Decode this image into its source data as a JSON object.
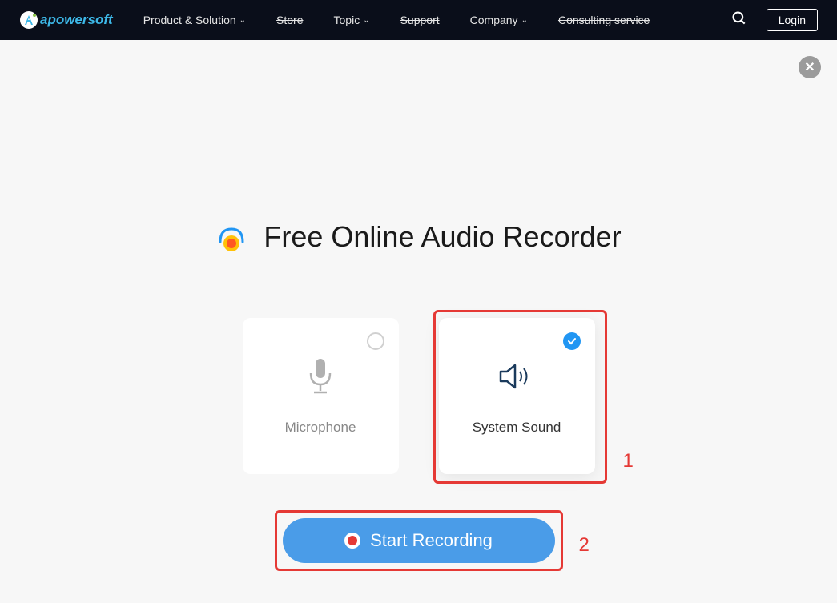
{
  "brand": {
    "name": "apowersoft"
  },
  "nav": {
    "items": [
      {
        "label": "Product & Solution",
        "dropdown": true,
        "strike": false
      },
      {
        "label": "Store",
        "dropdown": false,
        "strike": true
      },
      {
        "label": "Topic",
        "dropdown": true,
        "strike": false
      },
      {
        "label": "Support",
        "dropdown": false,
        "strike": true
      },
      {
        "label": "Company",
        "dropdown": true,
        "strike": false
      },
      {
        "label": "Consulting service",
        "dropdown": false,
        "strike": true
      }
    ],
    "login": "Login"
  },
  "page": {
    "title": "Free Online Audio Recorder"
  },
  "options": {
    "microphone": {
      "label": "Microphone",
      "selected": false
    },
    "system_sound": {
      "label": "System Sound",
      "selected": true
    }
  },
  "actions": {
    "start": "Start Recording"
  },
  "annotations": {
    "one": "1",
    "two": "2"
  }
}
